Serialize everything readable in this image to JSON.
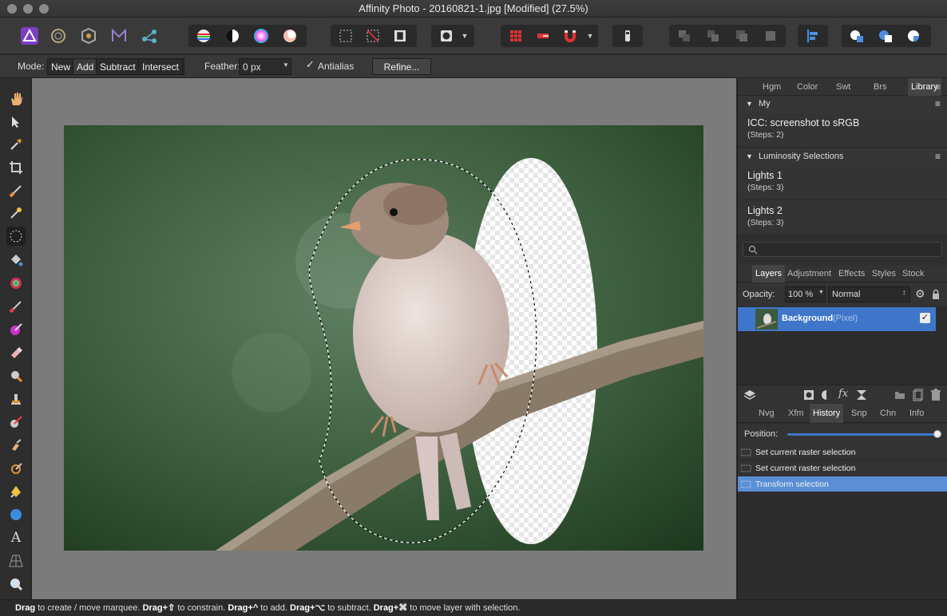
{
  "window": {
    "title": "Affinity Photo - 20160821-1.jpg [Modified] (27.5%)"
  },
  "context_bar": {
    "mode_label": "Mode:",
    "modes": [
      "New",
      "Add",
      "Subtract",
      "Intersect"
    ],
    "feather_label": "Feather:",
    "feather_value": "0 px",
    "antialias_label": "Antialias",
    "antialias_checked": true,
    "refine_label": "Refine..."
  },
  "top_panel": {
    "tabs": [
      "Hgm",
      "Color",
      "Swt",
      "Brs",
      "Library"
    ],
    "active_tab": "Library",
    "sections": [
      {
        "title": "My",
        "macros": [
          {
            "name": "ICC: screenshot to sRGB",
            "steps": "(Steps: 2)"
          }
        ]
      },
      {
        "title": "Luminosity Selections",
        "macros": [
          {
            "name": "Lights 1",
            "steps": "(Steps: 3)"
          },
          {
            "name": "Lights 2",
            "steps": "(Steps: 3)"
          }
        ]
      }
    ],
    "search_placeholder": ""
  },
  "layers_panel": {
    "tabs": [
      "Layers",
      "Adjustment",
      "Effects",
      "Styles",
      "Stock"
    ],
    "active_tab": "Layers",
    "opacity_label": "Opacity:",
    "opacity_value": "100 %",
    "blend_mode": "Normal",
    "layers": [
      {
        "name": "Background",
        "type": "(Pixel)",
        "visible": true,
        "selected": true
      }
    ]
  },
  "history_panel": {
    "tabs": [
      "Nvg",
      "Xfm",
      "History",
      "Snp",
      "Chn",
      "Info"
    ],
    "active_tab": "History",
    "position_label": "Position:",
    "position_fraction": 1.0,
    "items": [
      {
        "label": "Set current raster selection",
        "selected": false
      },
      {
        "label": "Set current raster selection",
        "selected": false
      },
      {
        "label": "Transform selection",
        "selected": true
      }
    ]
  },
  "status_bar": {
    "parts": [
      {
        "bold": "Drag",
        "text": " to create / move marquee. "
      },
      {
        "bold": "Drag+⇧",
        "text": " to constrain. "
      },
      {
        "bold": "Drag+^",
        "text": " to add. "
      },
      {
        "bold": "Drag+⌥",
        "text": " to subtract. "
      },
      {
        "bold": "Drag+⌘",
        "text": " to move layer with selection."
      }
    ]
  },
  "colors": {
    "accent": "#3f76c9",
    "selection_row": "#5a8fd6",
    "canvas_bg": "#7b7b7b"
  }
}
